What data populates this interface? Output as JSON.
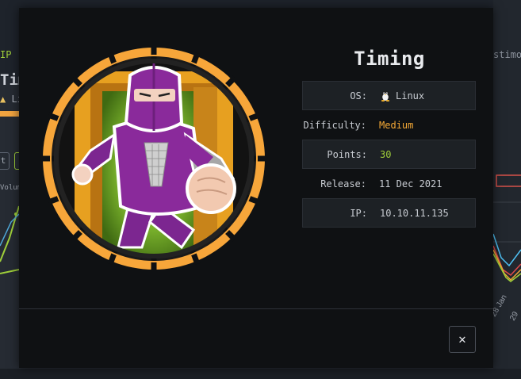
{
  "background": {
    "ip_label": "IP",
    "machine_name": "Tim",
    "os_text": "Li",
    "button_text": "t",
    "volume_label": "Volume",
    "testimonials_label": "stimon",
    "date_labels": [
      "28 Jan",
      "29"
    ]
  },
  "modal": {
    "title": "Timing",
    "rows": [
      {
        "label": "OS:",
        "value": "Linux",
        "icon": "linux-tux-icon"
      },
      {
        "label": "Difficulty:",
        "value": "Medium"
      },
      {
        "label": "Points:",
        "value": "30"
      },
      {
        "label": "Release:",
        "value": "11 Dec 2021"
      },
      {
        "label": "IP:",
        "value": "10.10.11.135"
      }
    ],
    "close_label": "✕"
  },
  "colors": {
    "accent_green": "#9fcf3a",
    "accent_orange": "#f5a936",
    "ring_orange": "#f7a63a",
    "ninja_purple": "#8a2a9b"
  }
}
